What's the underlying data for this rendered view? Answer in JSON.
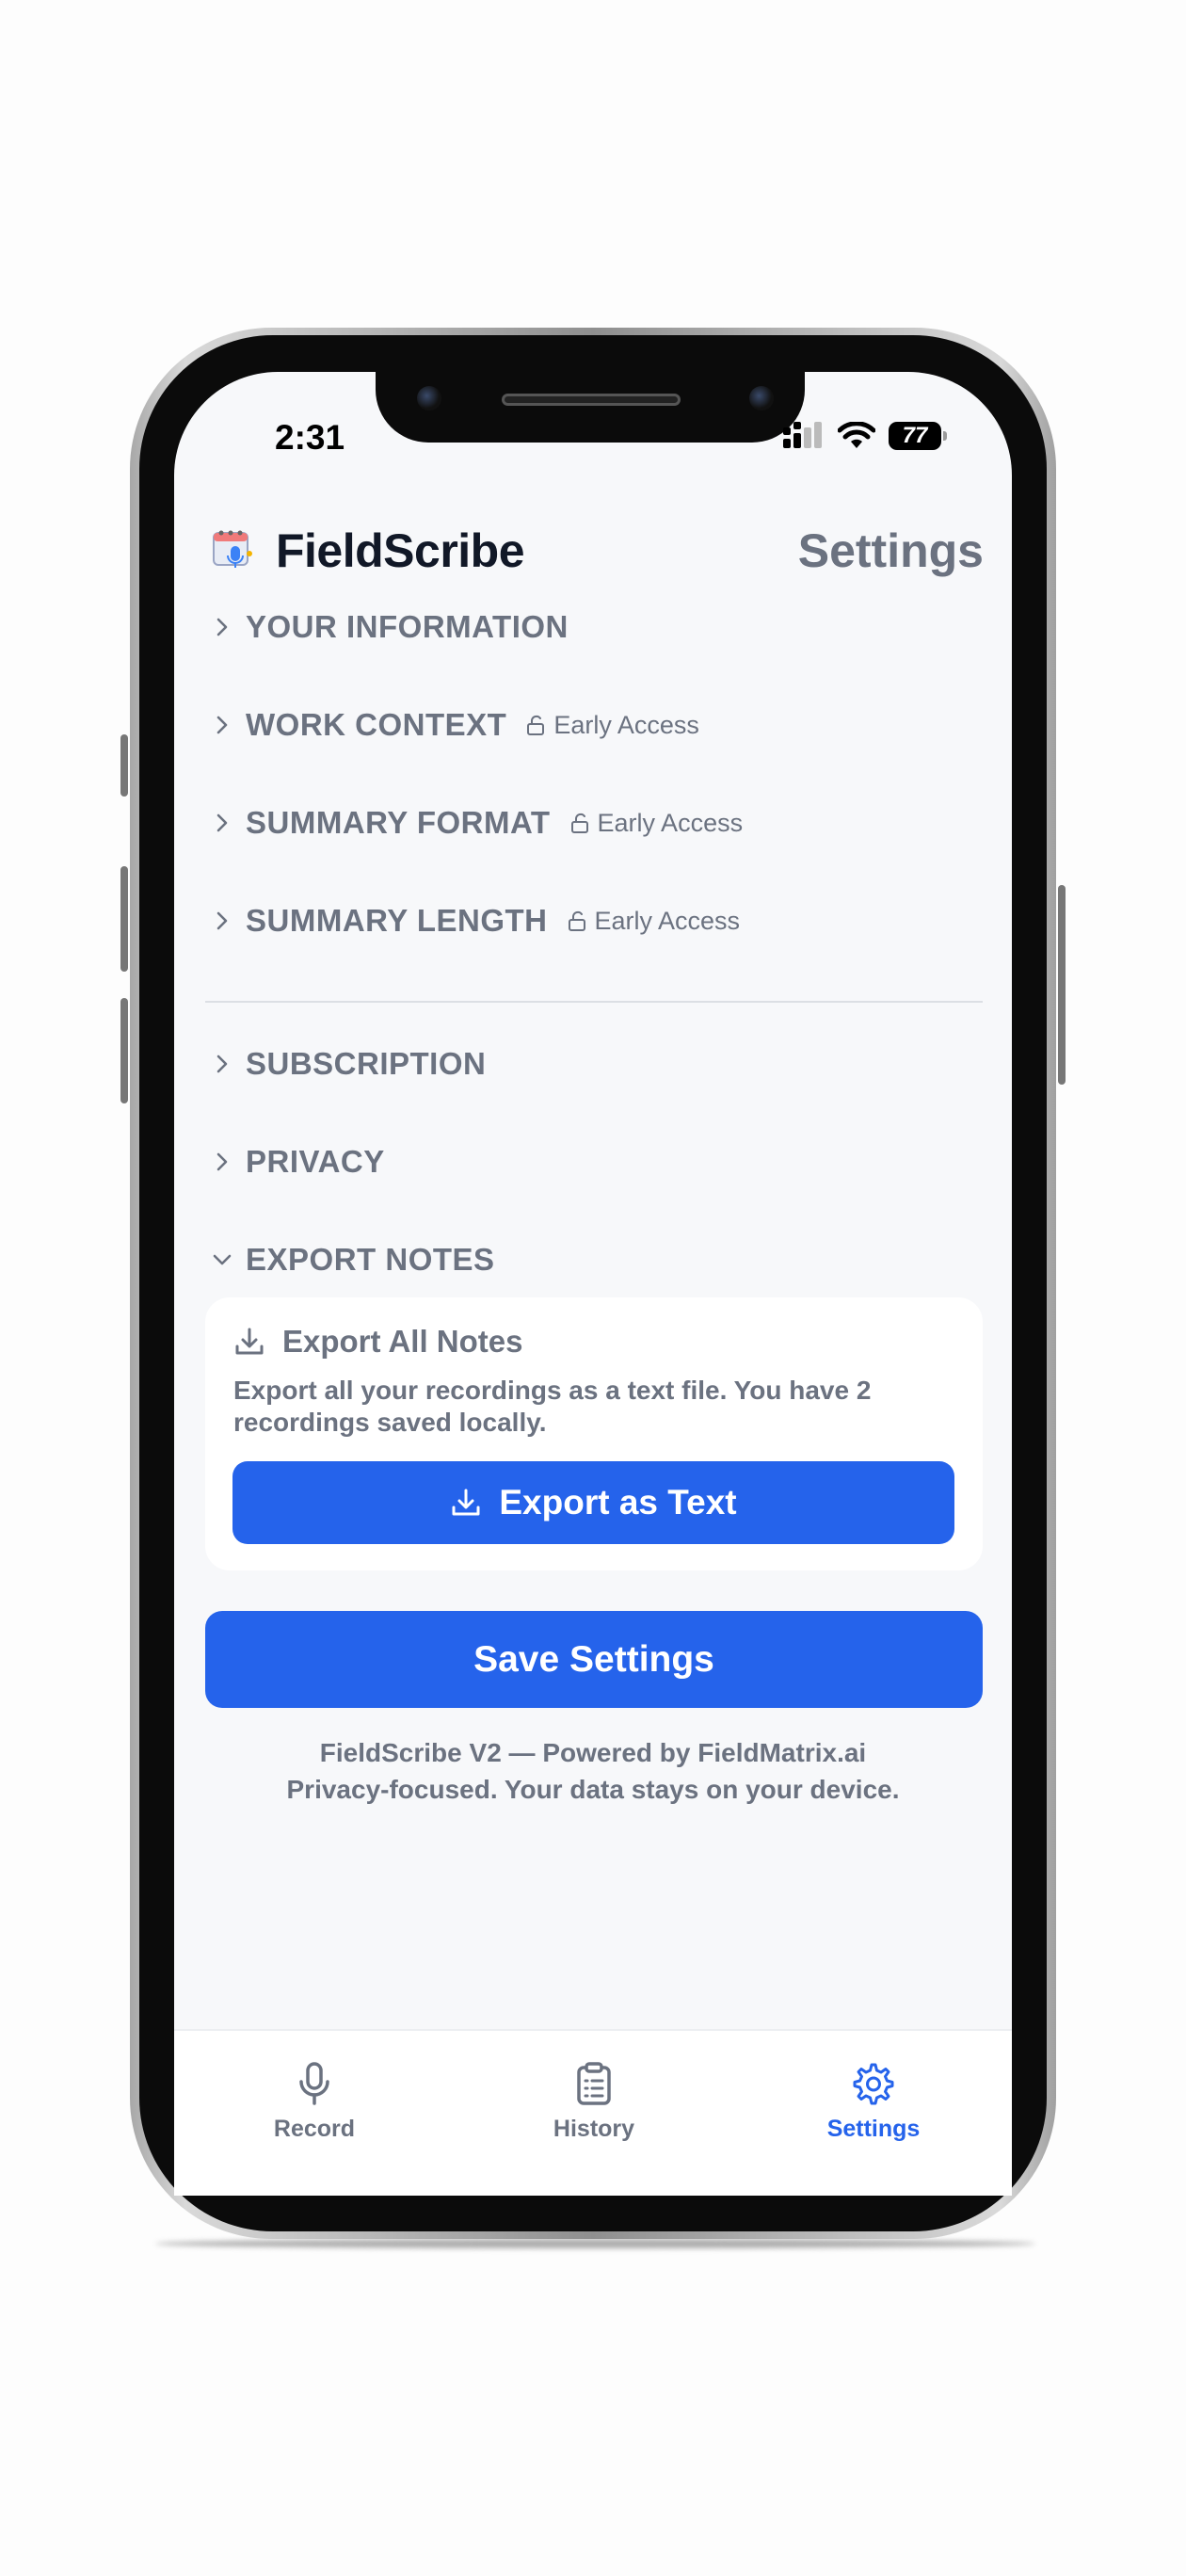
{
  "status_bar": {
    "time": "2:31",
    "battery": "77"
  },
  "header": {
    "app_name": "FieldScribe",
    "page_title": "Settings"
  },
  "sections": [
    {
      "label": "YOUR INFORMATION",
      "badge": ""
    },
    {
      "label": "WORK CONTEXT",
      "badge": "Early Access"
    },
    {
      "label": "SUMMARY FORMAT",
      "badge": "Early Access"
    },
    {
      "label": "SUMMARY LENGTH",
      "badge": "Early Access"
    },
    {
      "label": "SUBSCRIPTION",
      "badge": ""
    },
    {
      "label": "PRIVACY",
      "badge": ""
    },
    {
      "label": "EXPORT NOTES",
      "badge": "",
      "expanded": true
    }
  ],
  "export": {
    "title": "Export All Notes",
    "description": "Export all your recordings as a text file. You have 2 recordings saved locally.",
    "button_label": "Export as Text"
  },
  "save_button": "Save Settings",
  "footer": {
    "line1": "FieldScribe V2 — Powered by FieldMatrix.ai",
    "line2": "Privacy-focused. Your data stays on your device."
  },
  "tabs": [
    {
      "label": "Record",
      "icon": "microphone-icon",
      "active": false
    },
    {
      "label": "History",
      "icon": "clipboard-icon",
      "active": false
    },
    {
      "label": "Settings",
      "icon": "gear-icon",
      "active": true
    }
  ],
  "colors": {
    "accent": "#2563eb",
    "text_muted": "#6b7280",
    "text_dark": "#111827",
    "background": "#f7f8fa"
  }
}
